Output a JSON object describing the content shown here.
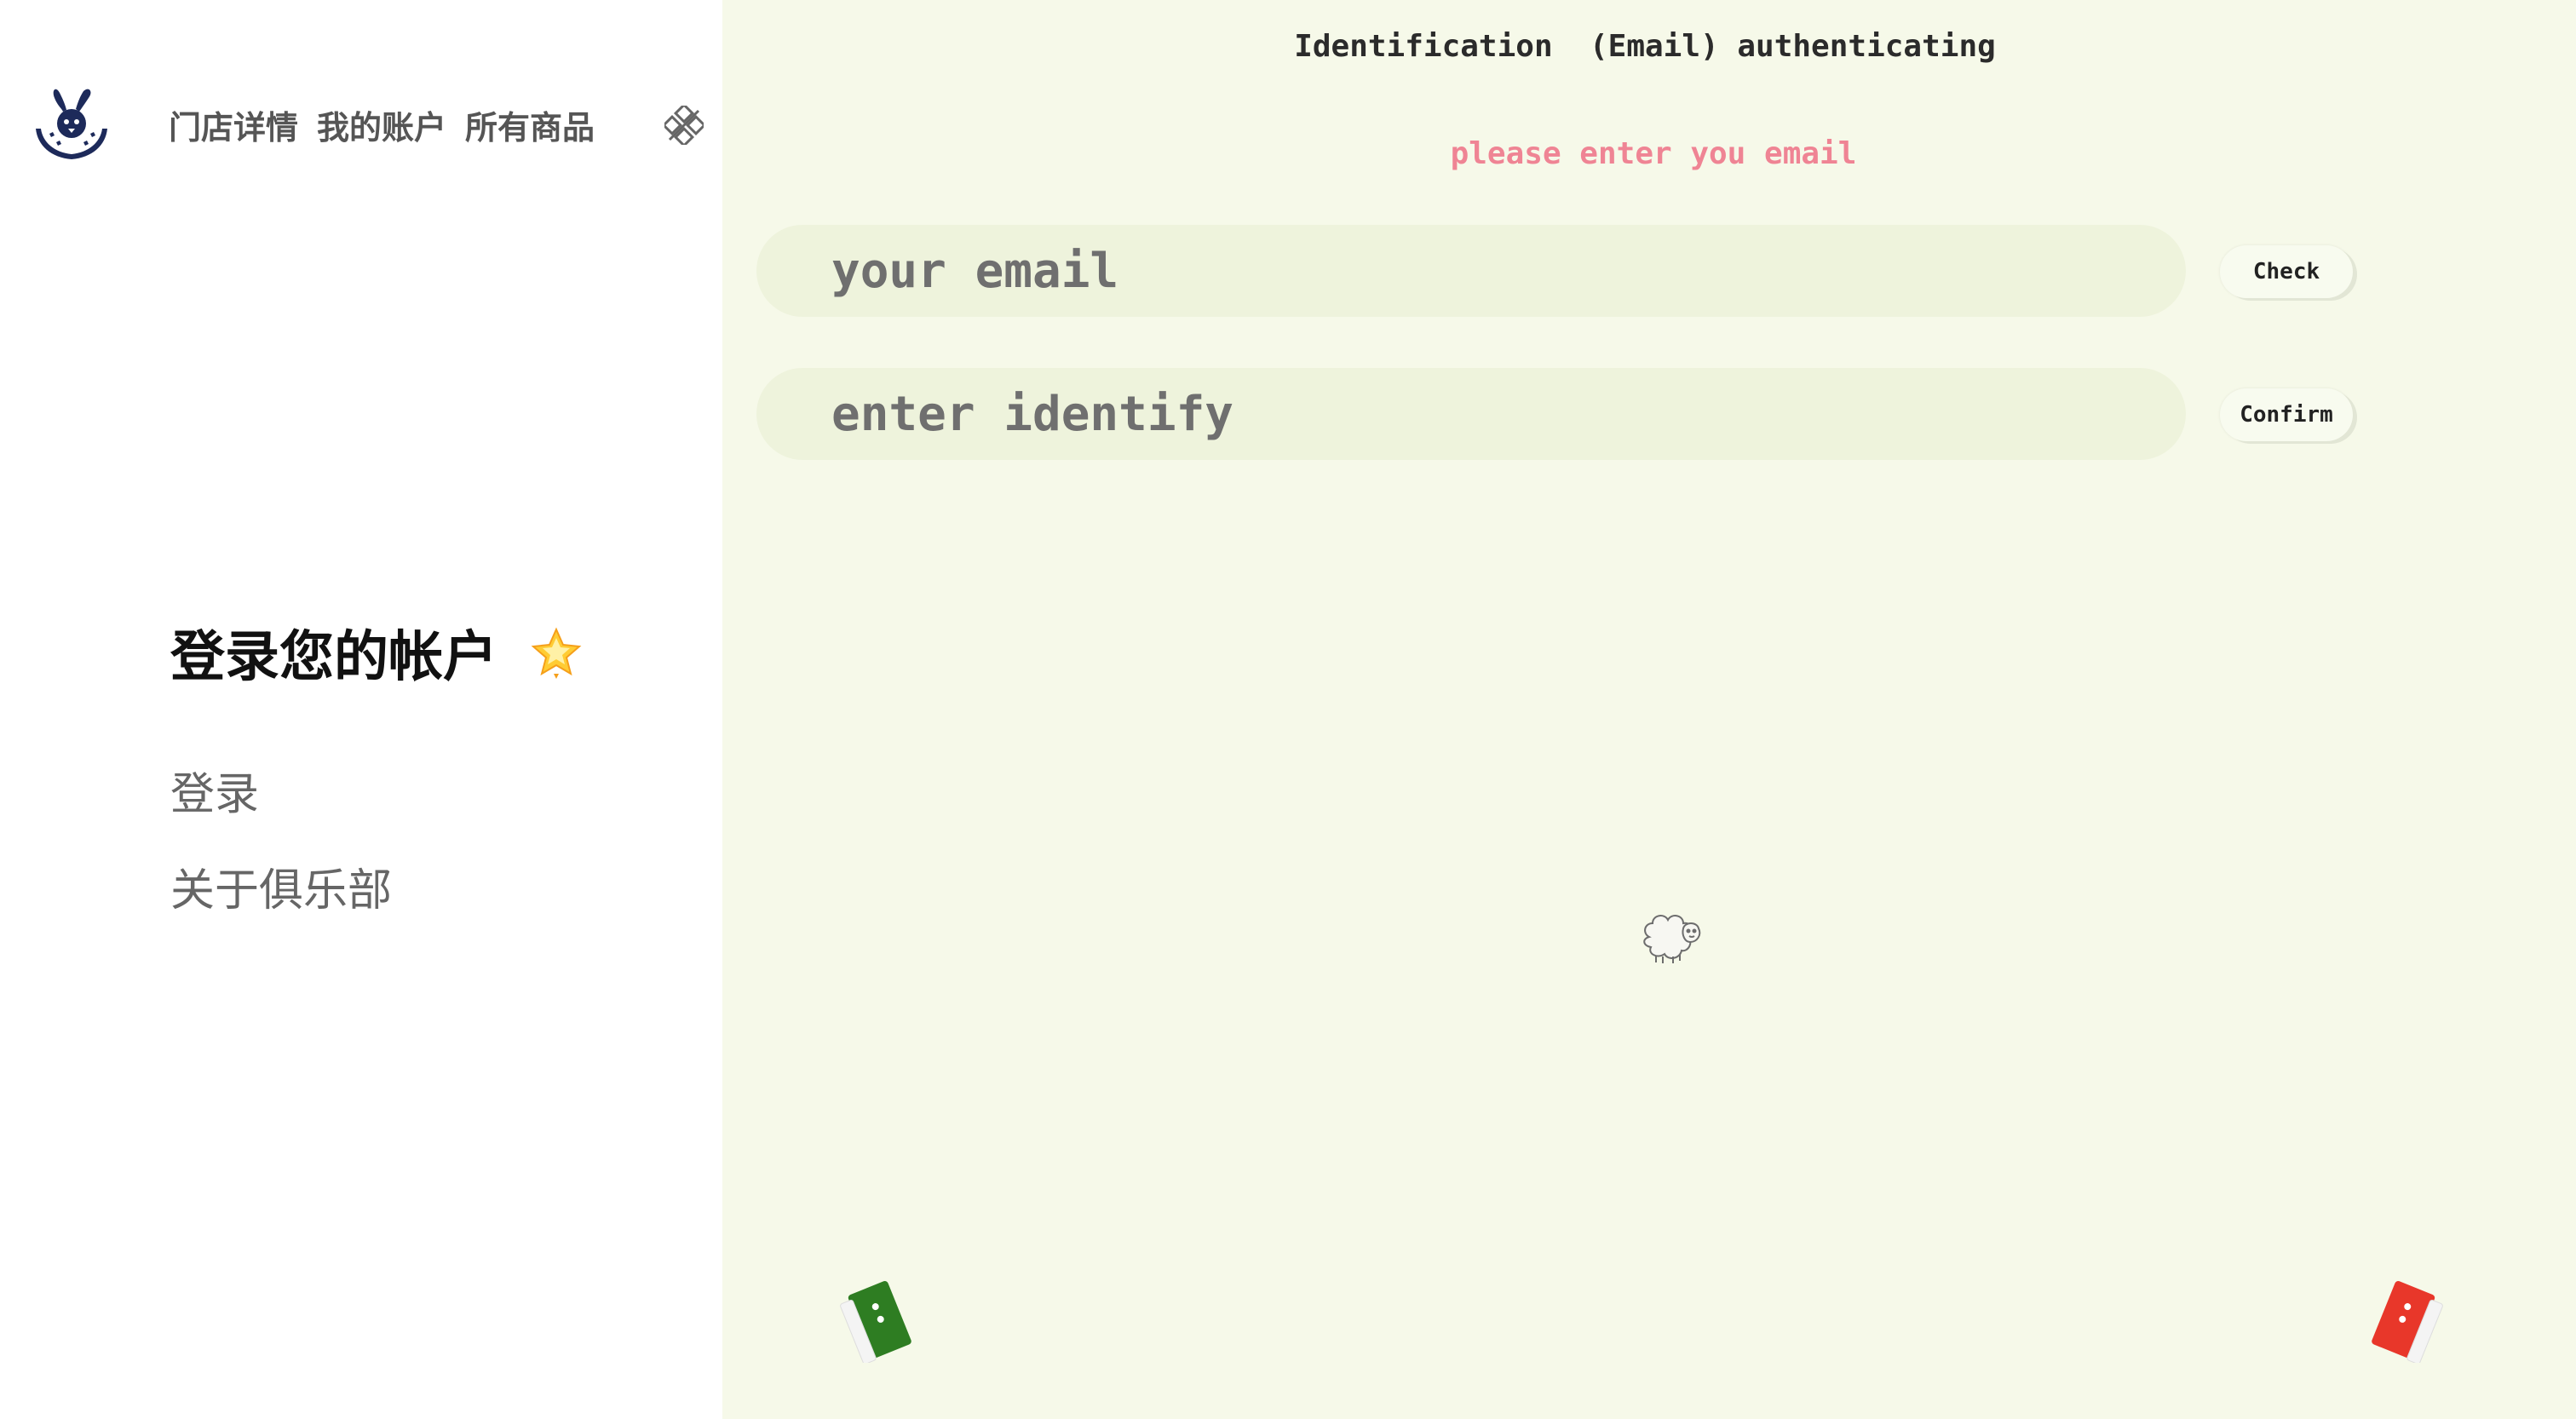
{
  "nav": {
    "logo": "rabbit-club-logo",
    "links": [
      "门店详情",
      "我的账户",
      "所有商品"
    ],
    "menu_icon": "diamond-grid-icon"
  },
  "login": {
    "title": "登录您的帐户",
    "title_icon": "star-icon",
    "items": [
      "登录",
      "关于俱乐部"
    ]
  },
  "panel": {
    "title": "Identification  (Email) authenticating",
    "hint": "please enter you email",
    "email_placeholder": "your email",
    "code_placeholder": "enter identify",
    "check_label": "Check",
    "confirm_label": "Confirm",
    "mascot": "sheep-icon"
  },
  "colors": {
    "panel_bg": "#f6f9e9",
    "field_bg": "#eef3dc",
    "hint": "#ef8494",
    "green_toggle": "#2e7d22",
    "red_toggle": "#e8372a"
  }
}
